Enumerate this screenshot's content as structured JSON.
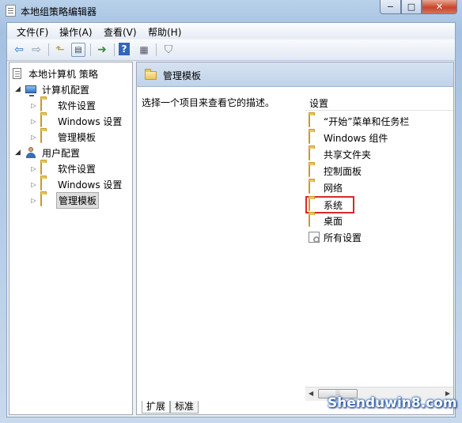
{
  "window": {
    "title": "本地组策略编辑器",
    "controls": {
      "minimize": "−",
      "maximize": "□",
      "close": "✕"
    }
  },
  "menu": [
    "文件(F)",
    "操作(A)",
    "查看(V)",
    "帮助(H)"
  ],
  "toolbar": {
    "icons": [
      "back-arrow-icon",
      "forward-arrow-icon",
      "up-folder-icon",
      "show-hide-tree-icon",
      "export-list-icon",
      "help-icon",
      "properties-icon",
      "filter-icon"
    ]
  },
  "tree": {
    "root": "本地计算机 策略",
    "computer": "计算机配置",
    "computer_children": [
      "软件设置",
      "Windows 设置",
      "管理模板"
    ],
    "user": "用户配置",
    "user_children": [
      "软件设置",
      "Windows 设置",
      "管理模板"
    ],
    "selected": "管理模板"
  },
  "right": {
    "header_title": "管理模板",
    "description": "选择一个项目来查看它的描述。",
    "column_header": "设置",
    "items": [
      "“开始”菜单和任务栏",
      "Windows 组件",
      "共享文件夹",
      "控制面板",
      "网络",
      "系统",
      "桌面",
      "所有设置"
    ],
    "highlighted": "系统"
  },
  "tabs": [
    "扩展",
    "标准"
  ],
  "watermark": "Shenduwin8.com"
}
